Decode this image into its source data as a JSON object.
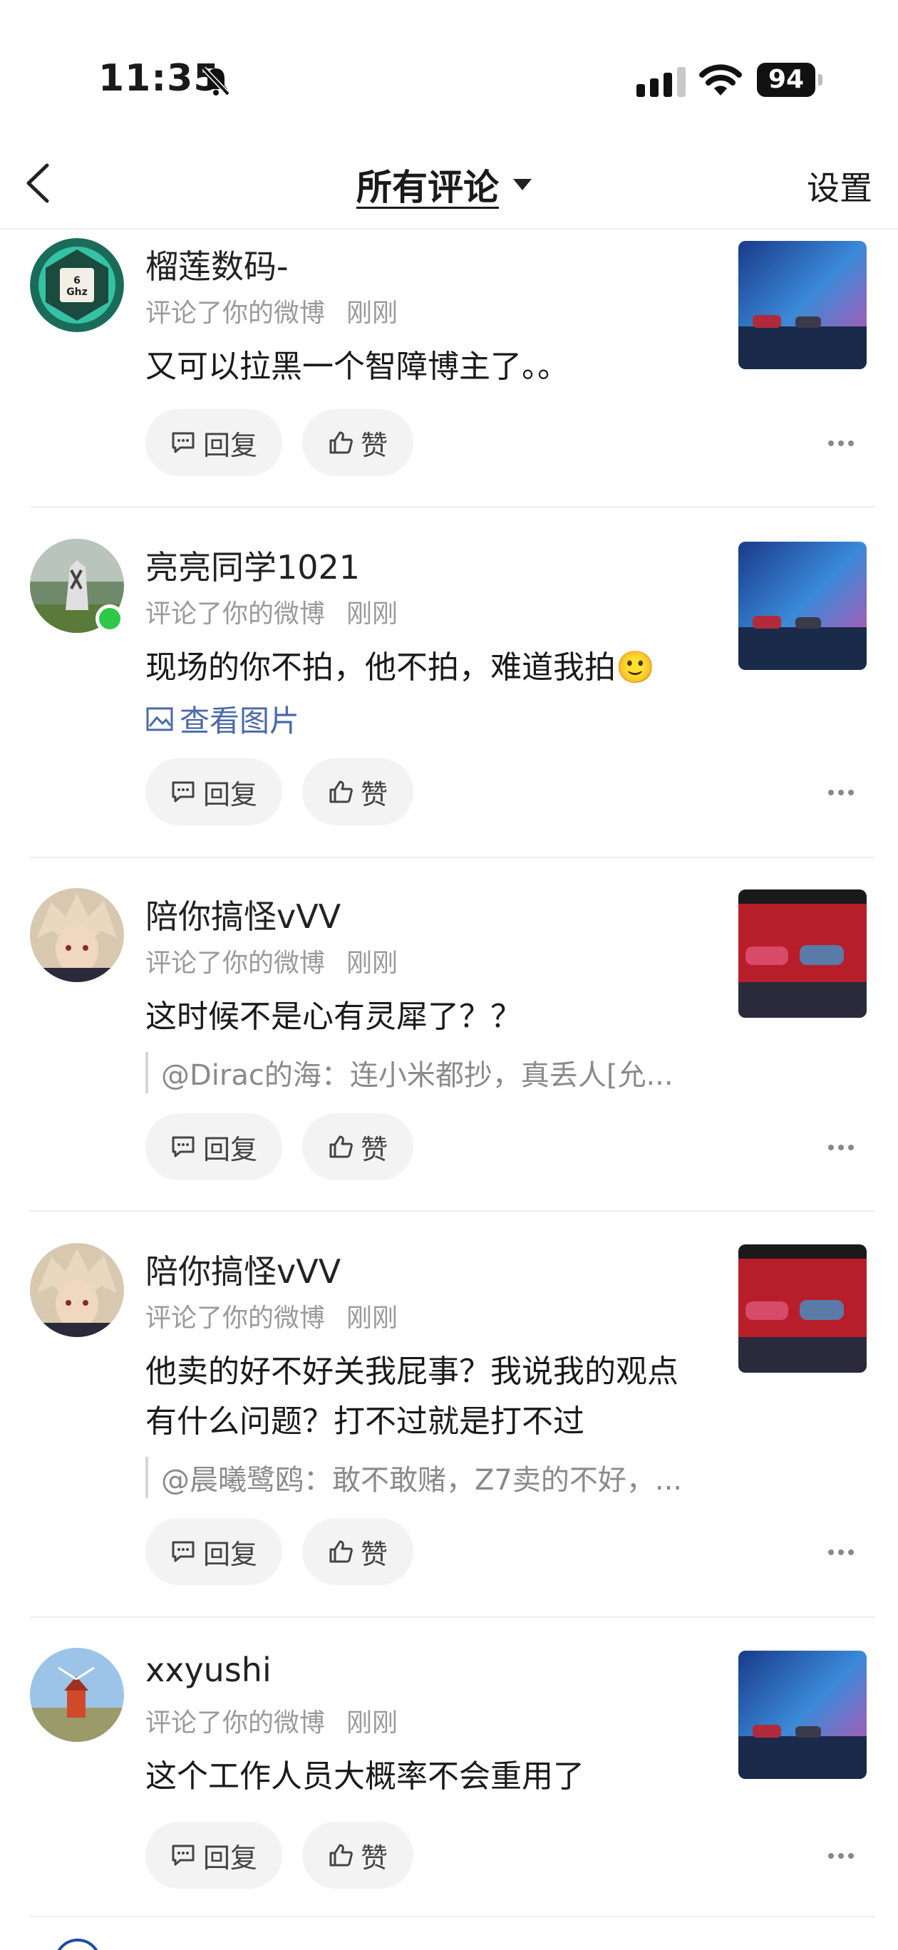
{
  "status_bar": {
    "time": "11:35",
    "battery": "94",
    "icons": [
      "bell-slash-icon",
      "signal-icon",
      "wifi-icon",
      "battery-icon"
    ]
  },
  "nav": {
    "title": "所有评论",
    "settings": "设置",
    "back_icon": "chevron-left-icon"
  },
  "buttons": {
    "reply": "回复",
    "like": "赞"
  },
  "comments": [
    {
      "username": "榴莲数码-",
      "action": "评论了你的微博",
      "time": "刚刚",
      "text": "又可以拉黑一个智障博主了。。"
    },
    {
      "username": "亮亮同学1021",
      "action": "评论了你的微博",
      "time": "刚刚",
      "text": "现场的你不拍，他不拍，难道我拍🙂",
      "view_image": "查看图片"
    },
    {
      "username": "陪你搞怪vVV",
      "action": "评论了你的微博",
      "time": "刚刚",
      "text": "这时候不是心有灵犀了？？",
      "quote": "@Dirac的海：连小米都抄，真丢人[允..."
    },
    {
      "username": "陪你搞怪vVV",
      "action": "评论了你的微博",
      "time": "刚刚",
      "text": "他卖的好不好关我屁事？我说我的观点有什么问题？打不过就是打不过",
      "quote": "@晨曦鹭鸥：敢不敢赌，Z7卖的不好，..."
    },
    {
      "username": "xxyushi",
      "action": "评论了你的微博",
      "time": "刚刚",
      "text": "这个工作人员大概率不会重用了"
    }
  ]
}
